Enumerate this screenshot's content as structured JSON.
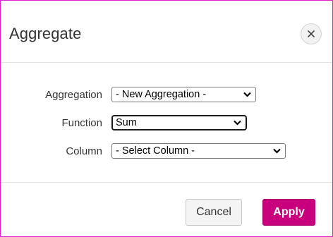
{
  "dialog": {
    "title": "Aggregate",
    "close_icon": "close-icon"
  },
  "form": {
    "aggregation": {
      "label": "Aggregation",
      "value": "- New Aggregation -"
    },
    "function": {
      "label": "Function",
      "value": "Sum"
    },
    "column": {
      "label": "Column",
      "value": "- Select Column -"
    }
  },
  "footer": {
    "cancel_label": "Cancel",
    "apply_label": "Apply"
  },
  "colors": {
    "accent": "#c8007d",
    "dialog_border": "#e020c8"
  }
}
